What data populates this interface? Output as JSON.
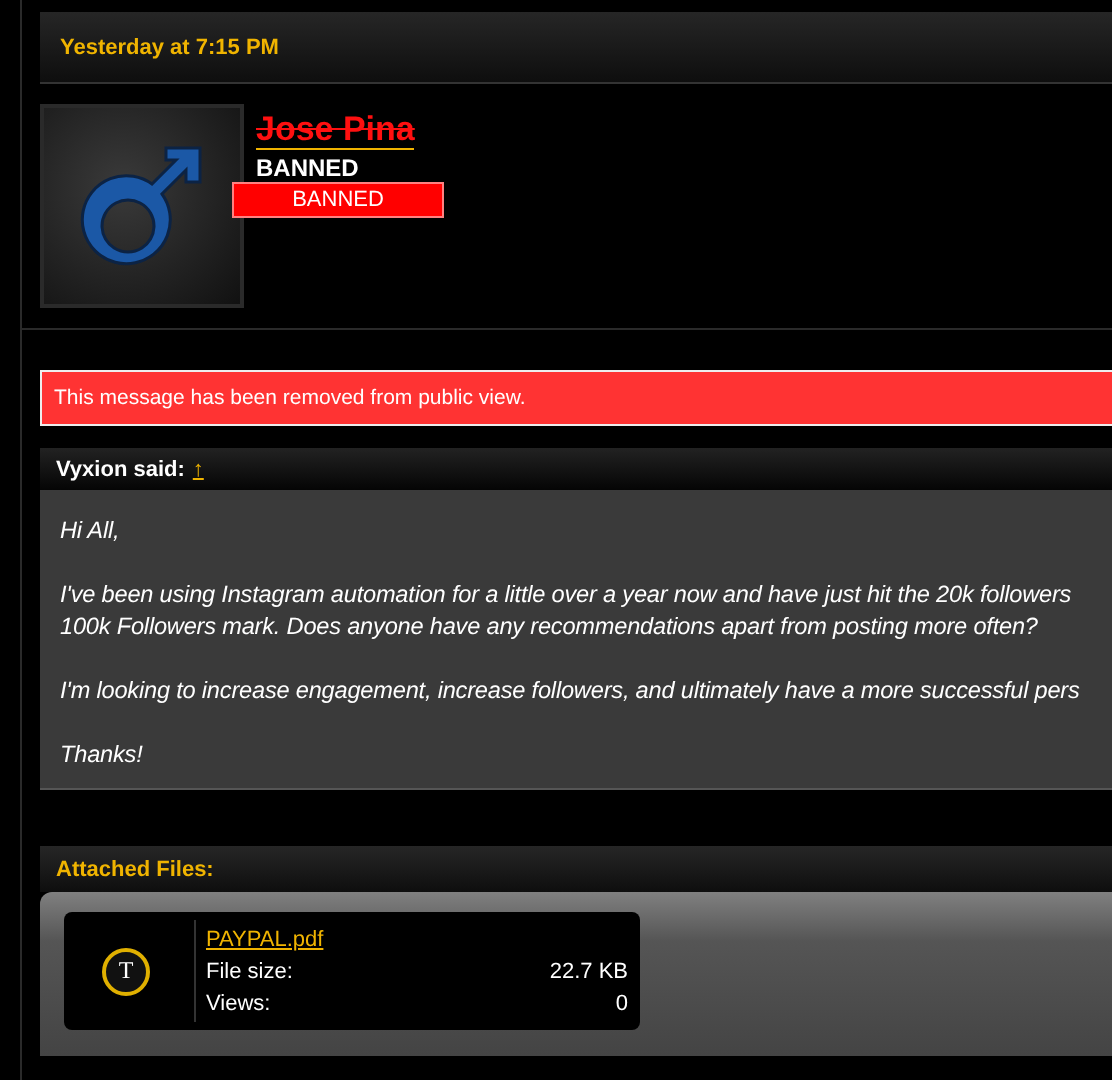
{
  "post": {
    "date": "Yesterday at 7:15 PM",
    "user": {
      "name": "Jose Pina",
      "banned": true,
      "title": "BANNED",
      "banner": "BANNED"
    },
    "notice": "This message has been removed from public view.",
    "quote": {
      "author": "Vyxion said:",
      "jump": "↑",
      "paragraphs": [
        [
          "Hi All,"
        ],
        [
          "I've been using Instagram automation for a little over a year now and have just hit the 20k followers",
          "100k Followers mark. Does anyone have any recommendations apart from posting more often?"
        ],
        [
          "I'm looking to increase engagement, increase followers, and ultimately have a more successful pers"
        ],
        [
          "Thanks!"
        ]
      ]
    },
    "attachments": {
      "title": "Attached Files:",
      "files": [
        {
          "icon": "T",
          "name": "PAYPAL.pdf",
          "size_label": "File size:",
          "size": "22.7 KB",
          "views_label": "Views:",
          "views": "0"
        }
      ]
    }
  }
}
